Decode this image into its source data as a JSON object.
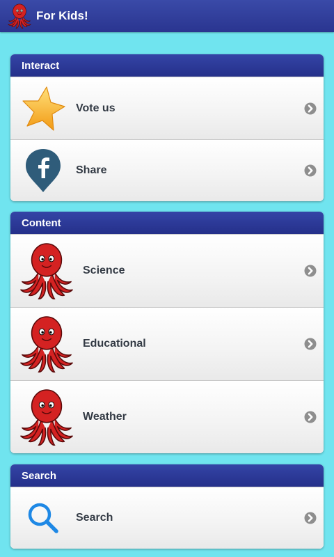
{
  "app": {
    "title": "For Kids!",
    "logo_icon": "octopus-icon",
    "bar_color": "#2a3590",
    "background": "#70e4ef"
  },
  "sections": [
    {
      "header": "Interact",
      "items": [
        {
          "label": "Vote us",
          "icon": "star-icon"
        },
        {
          "label": "Share",
          "icon": "facebook-icon"
        }
      ]
    },
    {
      "header": "Content",
      "items": [
        {
          "label": "Science",
          "icon": "octopus-icon"
        },
        {
          "label": "Educational",
          "icon": "octopus-icon"
        },
        {
          "label": "Weather",
          "icon": "octopus-icon"
        }
      ]
    },
    {
      "header": "Search",
      "items": [
        {
          "label": "Search",
          "icon": "search-icon"
        }
      ]
    }
  ]
}
